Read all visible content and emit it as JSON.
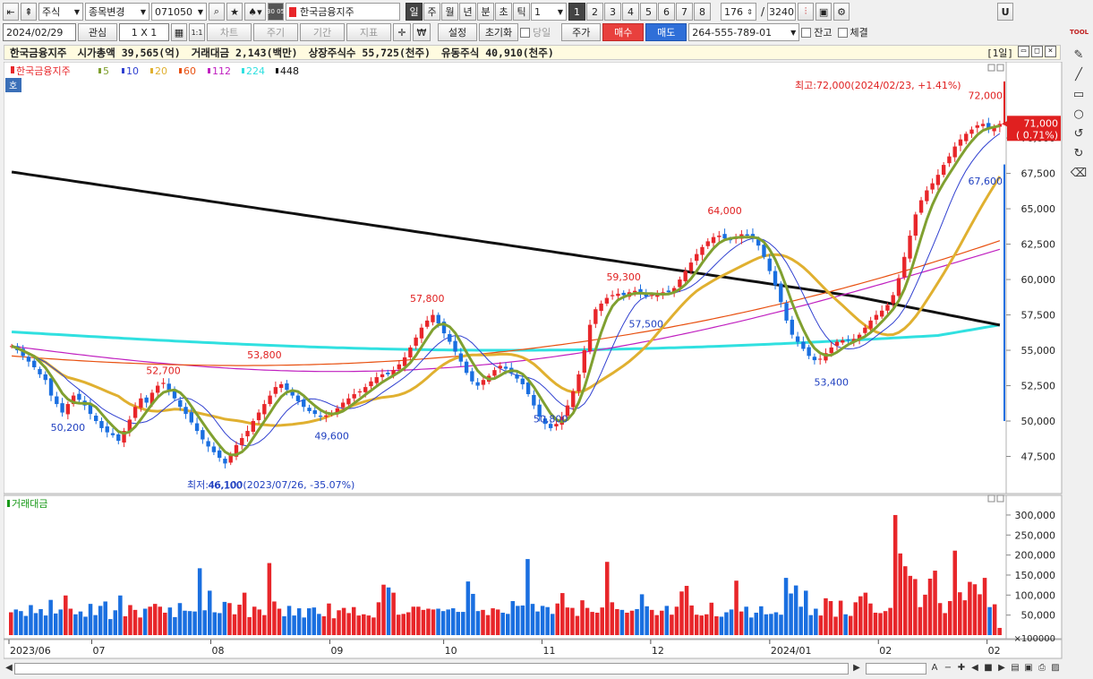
{
  "toolbar1": {
    "market_select": "주식",
    "change_select": "종목변경",
    "code_value": "071050",
    "period_code": "30 05",
    "stock_name": "한국금융지주",
    "tabs": [
      "일",
      "주",
      "월",
      "년",
      "분",
      "초",
      "틱"
    ],
    "active_tab": "일",
    "interval_value": "1",
    "pages": [
      "1",
      "2",
      "3",
      "4",
      "5",
      "6",
      "7",
      "8"
    ],
    "active_page": "1",
    "count_value": "176",
    "slash": "/",
    "total_value": "3240",
    "u_label": "U"
  },
  "toolbar2": {
    "date_value": "2024/02/29",
    "watch_label": "관심",
    "layout_value": "1 X 1",
    "one_label": "1:1",
    "won_label": "₩",
    "setup_label": "설정",
    "reset_label": "초기화",
    "today_label": "당일",
    "price_label": "주가",
    "buy_label": "매수",
    "sell_label": "매도",
    "account_value": "264-555-789-01",
    "balance_label": "잔고",
    "filled_label": "체결",
    "sidebar_tool_label": "TOOL",
    "greyed": [
      "차트",
      "주기",
      "기간",
      "지표"
    ]
  },
  "infobar": {
    "name": "한국금융지주",
    "market_cap": "시가총액 39,565(억)",
    "trade_value": "거래대금 2,143(백만)",
    "listed_shares": "상장주식수 55,725(천주)",
    "float_shares": "유동주식 40,910(천주)",
    "period": "[1일]"
  },
  "colors": {
    "up": "#e8262a",
    "down": "#1a6fe0",
    "ma5": "#e02020",
    "ma10": "#3040d0",
    "ma20": "#e0b030",
    "ma60": "#e85010",
    "ma112": "#c020c0",
    "ma224": "#30e0e0",
    "ma448": "#111111",
    "green_line": "#80a030"
  },
  "chart_data": {
    "type": "candlestick",
    "ticker_legend": "한국금융지주",
    "ma_legend": [
      "5",
      "10",
      "20",
      "60",
      "112",
      "224",
      "448"
    ],
    "ylim": [
      45000,
      74500
    ],
    "y_ticks": [
      "47,500",
      "50,000",
      "52,500",
      "55,000",
      "57,500",
      "60,000",
      "62,500",
      "65,000",
      "67,500",
      "70,000"
    ],
    "x_labels": [
      "2023/06",
      "07",
      "08",
      "09",
      "10",
      "11",
      "12",
      "2024/01",
      "02",
      "02"
    ],
    "last_price": "71,000",
    "last_change": "( 0.71%)",
    "high_note": "최고:72,000(2024/02/23, +1.41%)",
    "low_note": "최저:46,100(2023/07/26, -35.07%)",
    "annotations": [
      {
        "text": "72,000",
        "color": "red"
      },
      {
        "text": "67,600",
        "color": "blue"
      },
      {
        "text": "64,000",
        "color": "red"
      },
      {
        "text": "59,300",
        "color": "red"
      },
      {
        "text": "57,500",
        "color": "blue"
      },
      {
        "text": "57,800",
        "color": "red"
      },
      {
        "text": "53,800",
        "color": "red"
      },
      {
        "text": "52,700",
        "color": "red"
      },
      {
        "text": "53,400",
        "color": "blue"
      },
      {
        "text": "50,800",
        "color": "blue"
      },
      {
        "text": "50,200",
        "color": "blue"
      },
      {
        "text": "49,600",
        "color": "blue"
      },
      {
        "text": "46,100",
        "color": "blue"
      }
    ],
    "closes": [
      55300,
      55000,
      54600,
      54200,
      53800,
      53300,
      52900,
      51800,
      51200,
      50600,
      51200,
      51800,
      51500,
      51100,
      50500,
      50000,
      49500,
      49200,
      49000,
      48600,
      49300,
      50100,
      51000,
      51600,
      51300,
      52000,
      52500,
      52700,
      52200,
      51600,
      51000,
      50500,
      49900,
      49300,
      48700,
      48200,
      47800,
      47400,
      47000,
      47600,
      48300,
      48800,
      49300,
      50000,
      50600,
      51200,
      51800,
      52400,
      52600,
      52200,
      51800,
      51400,
      51000,
      50700,
      50500,
      50300,
      50400,
      50600,
      50900,
      51300,
      51600,
      51900,
      52100,
      52400,
      52800,
      53100,
      53300,
      53300,
      53600,
      54000,
      54500,
      55200,
      55900,
      56600,
      57100,
      57500,
      56900,
      56200,
      55600,
      54900,
      54200,
      53400,
      52800,
      52500,
      52900,
      53200,
      53600,
      53900,
      53700,
      53400,
      53000,
      52600,
      51900,
      51100,
      50300,
      49800,
      49500,
      49800,
      50300,
      51100,
      52100,
      53300,
      55000,
      56800,
      57900,
      58300,
      58700,
      58900,
      59000,
      58900,
      59100,
      59200,
      59000,
      58800,
      58900,
      59000,
      59100,
      59100,
      59400,
      60000,
      60600,
      61200,
      61800,
      62300,
      62700,
      63000,
      63100,
      62900,
      62800,
      63000,
      63200,
      63100,
      62900,
      62400,
      61600,
      60600,
      59600,
      58400,
      57100,
      56100,
      55600,
      55100,
      54600,
      54300,
      54400,
      54800,
      55200,
      55600,
      55700,
      55700,
      55800,
      56100,
      56600,
      57100,
      57500,
      57800,
      58200,
      58900,
      60100,
      61600,
      63100,
      64600,
      65600,
      66300,
      66800,
      67400,
      68100,
      68700,
      69400,
      69900,
      70300,
      70600,
      70900,
      71000,
      70600,
      70800,
      71000
    ],
    "volumes_k100": [
      57,
      64,
      60,
      48,
      75,
      55,
      65,
      49,
      88,
      54,
      64,
      99,
      66,
      52,
      59,
      46,
      78,
      50,
      73,
      84,
      40,
      62,
      99,
      47,
      75,
      63,
      44,
      66,
      71,
      78,
      71,
      56,
      69,
      45,
      80,
      61,
      60,
      59,
      167,
      62,
      111,
      57,
      55,
      83,
      80,
      52,
      76,
      106,
      45,
      71,
      64,
      50,
      180,
      84,
      66,
      47,
      73,
      49,
      67,
      44,
      67,
      69,
      53,
      47,
      79,
      42,
      62,
      68,
      55,
      70,
      49,
      52,
      49,
      44,
      82,
      126,
      119,
      106,
      51,
      53,
      57,
      71,
      71,
      63,
      66,
      64,
      66,
      60,
      64,
      67,
      58,
      58,
      134,
      103,
      60,
      63,
      50,
      67,
      64,
      56,
      53,
      85,
      73,
      74,
      190,
      78,
      59,
      73,
      70,
      53,
      79,
      105,
      69,
      68,
      48,
      87,
      68,
      58,
      56,
      69,
      183,
      82,
      65,
      63,
      56,
      61,
      65,
      102,
      72,
      63,
      50,
      61,
      73,
      51,
      71,
      109,
      123,
      74,
      51,
      49,
      52,
      81,
      47,
      46,
      57,
      64,
      136,
      59,
      71,
      44,
      56,
      72,
      52,
      53,
      57,
      51,
      143,
      104,
      124,
      71,
      111,
      50,
      66,
      49,
      92,
      85,
      46,
      86,
      52,
      48,
      82,
      97,
      106,
      79,
      56,
      55,
      60,
      68,
      300,
      204,
      172,
      148,
      140,
      70,
      101,
      141,
      161,
      80,
      55,
      85,
      211,
      107,
      87,
      133,
      127,
      102,
      143,
      70,
      77,
      18
    ],
    "vol_ylim": [
      0,
      320000
    ],
    "vol_ticks": [
      "50,000",
      "100,000",
      "150,000",
      "200,000",
      "250,000",
      "300,000"
    ],
    "vol_unit": "×100000",
    "vol_legend": "거래대금"
  }
}
